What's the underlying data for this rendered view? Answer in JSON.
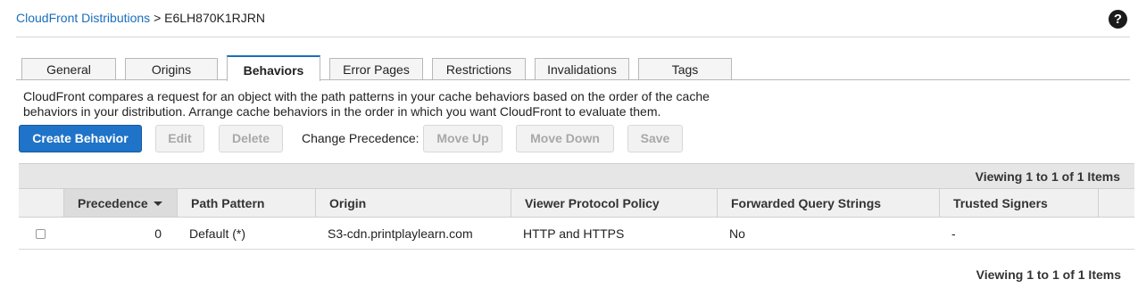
{
  "breadcrumb": {
    "link": "CloudFront Distributions",
    "separator": ">",
    "current": "E6LH870K1RJRN"
  },
  "help": {
    "icon": "question-circle-icon",
    "glyph": "?"
  },
  "tabs": [
    {
      "label": "General"
    },
    {
      "label": "Origins"
    },
    {
      "label": "Behaviors",
      "active": true
    },
    {
      "label": "Error Pages"
    },
    {
      "label": "Restrictions"
    },
    {
      "label": "Invalidations"
    },
    {
      "label": "Tags"
    }
  ],
  "description": {
    "line1": "CloudFront compares a request for an object with the path patterns in your cache behaviors based on the order of the cache",
    "line2": "behaviors in your distribution. Arrange cache behaviors in the order in which you want CloudFront to evaluate them."
  },
  "toolbar": {
    "create": "Create Behavior",
    "edit": "Edit",
    "delete": "Delete",
    "change_precedence": "Change Precedence:",
    "move_up": "Move Up",
    "move_down": "Move Down",
    "save": "Save"
  },
  "table": {
    "viewing": "Viewing 1 to 1 of 1 Items",
    "columns": {
      "precedence": "Precedence",
      "path_pattern": "Path Pattern",
      "origin": "Origin",
      "viewer_protocol_policy": "Viewer Protocol Policy",
      "forwarded_query_strings": "Forwarded Query Strings",
      "trusted_signers": "Trusted Signers"
    },
    "rows": [
      {
        "precedence": "0",
        "path_pattern": "Default (*)",
        "origin": "S3-cdn.printplaylearn.com",
        "viewer_protocol_policy": "HTTP and HTTPS",
        "forwarded_query_strings": "No",
        "trusted_signers": "-"
      }
    ],
    "footer_viewing": "Viewing 1 to 1 of 1 Items"
  },
  "colors": {
    "accent": "#1f73c8",
    "link": "#1a6ebd"
  }
}
